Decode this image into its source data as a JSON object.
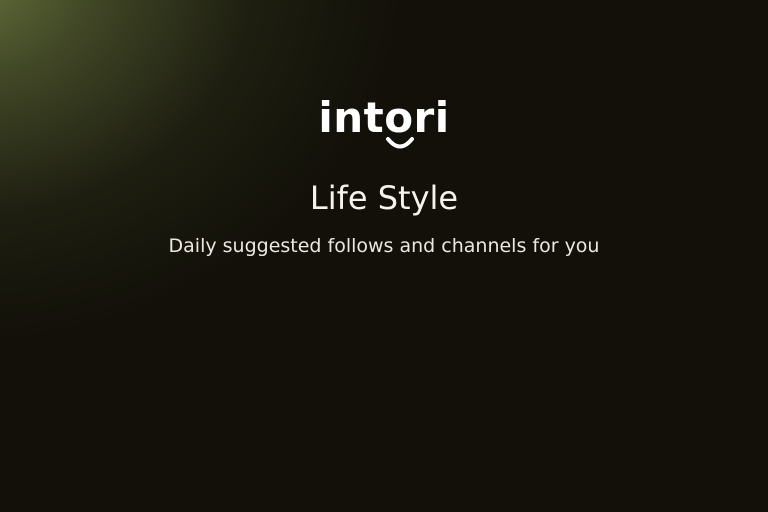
{
  "brand": {
    "logo_text": "intori"
  },
  "screen": {
    "title": "Life Style",
    "subtitle": "Daily suggested follows and channels for you"
  },
  "colors": {
    "background": "#121009",
    "accent_glow": "#707c42",
    "text": "#f4f1ea"
  }
}
